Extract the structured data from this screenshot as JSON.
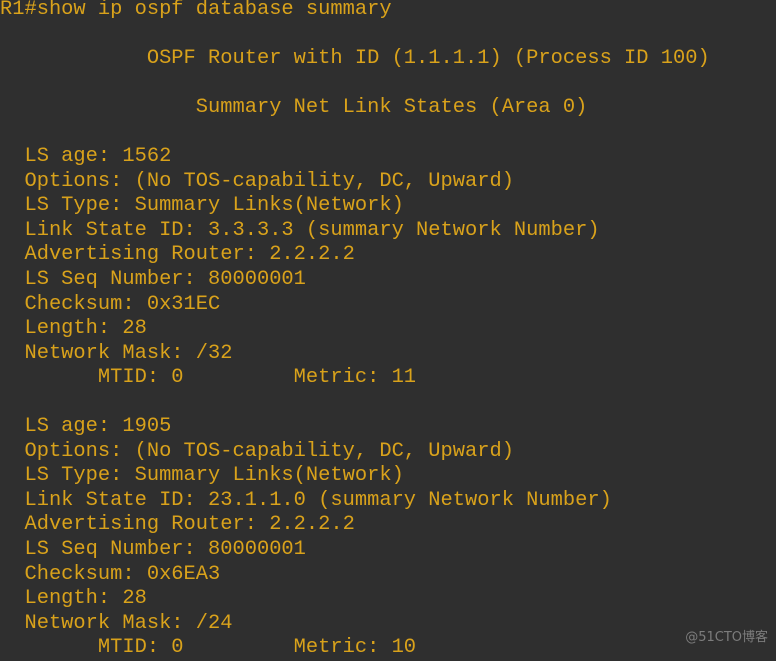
{
  "terminal": {
    "command_line": "R1#show ip ospf database summary",
    "router_header": "            OSPF Router with ID (1.1.1.1) (Process ID 100)",
    "area_header": "                Summary Net Link States (Area 0)",
    "lsas": [
      {
        "ls_age": "  LS age: 1562",
        "options": "  Options: (No TOS-capability, DC, Upward)",
        "ls_type": "  LS Type: Summary Links(Network)",
        "link_state_id": "  Link State ID: 3.3.3.3 (summary Network Number)",
        "advertising_router": "  Advertising Router: 2.2.2.2",
        "ls_seq_number": "  LS Seq Number: 80000001",
        "checksum": "  Checksum: 0x31EC",
        "length": "  Length: 28",
        "network_mask": "  Network Mask: /32",
        "mtid_metric": "        MTID: 0         Metric: 11"
      },
      {
        "ls_age": "  LS age: 1905",
        "options": "  Options: (No TOS-capability, DC, Upward)",
        "ls_type": "  LS Type: Summary Links(Network)",
        "link_state_id": "  Link State ID: 23.1.1.0 (summary Network Number)",
        "advertising_router": "  Advertising Router: 2.2.2.2",
        "ls_seq_number": "  LS Seq Number: 80000001",
        "checksum": "  Checksum: 0x6EA3",
        "length": "  Length: 28",
        "network_mask": "  Network Mask: /24",
        "mtid_metric": "        MTID: 0         Metric: 10"
      }
    ]
  },
  "watermark": "@51CTO博客",
  "colors": {
    "background": "#2f2f2f",
    "text": "#d9a21b",
    "watermark": "#8a8a8a"
  }
}
